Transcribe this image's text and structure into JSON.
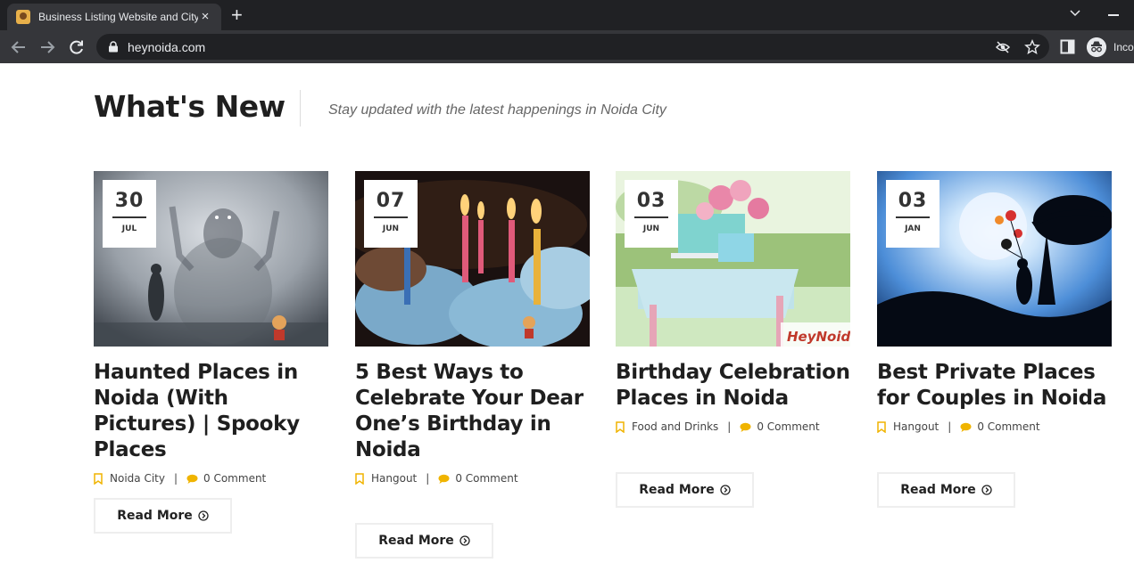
{
  "browser": {
    "tab_title": "Business Listing Website and City Guide",
    "tab_close": "×",
    "new_tab": "+",
    "url": "heynoida.com",
    "incognito_label": "Incognito"
  },
  "section": {
    "title": "What's New",
    "subtitle": "Stay updated with the latest happenings in Noida City"
  },
  "posts": [
    {
      "day": "30",
      "month": "JUL",
      "title": "Haunted Places in Noida (With Pictures) | Spooky Places",
      "category": "Noida City",
      "comments": "0 Comment",
      "separator": "|",
      "read_more": "Read More",
      "image_icon": "ghost-fog-image"
    },
    {
      "day": "07",
      "month": "JUN",
      "title": "5 Best Ways to Celebrate Your Dear One’s Birthday in Noida",
      "category": "Hangout",
      "comments": "0 Comment",
      "separator": "|",
      "read_more": "Read More",
      "image_icon": "birthday-candles-image"
    },
    {
      "day": "03",
      "month": "JUN",
      "title": "Birthday Celebration Places in Noida",
      "category": "Food and Drinks",
      "comments": "0 Comment",
      "separator": "|",
      "read_more": "Read More",
      "image_icon": "cake-table-image",
      "watermark": "HeyNoida"
    },
    {
      "day": "03",
      "month": "JAN",
      "title": "Best Private Places for Couples in Noida",
      "category": "Hangout",
      "comments": "0 Comment",
      "separator": "|",
      "read_more": "Read More",
      "image_icon": "couple-silhouette-image"
    }
  ],
  "colors": {
    "accent": "#f0b400",
    "chrome_dark": "#202124",
    "chrome_mid": "#35363a",
    "text": "#1f1f1f"
  }
}
